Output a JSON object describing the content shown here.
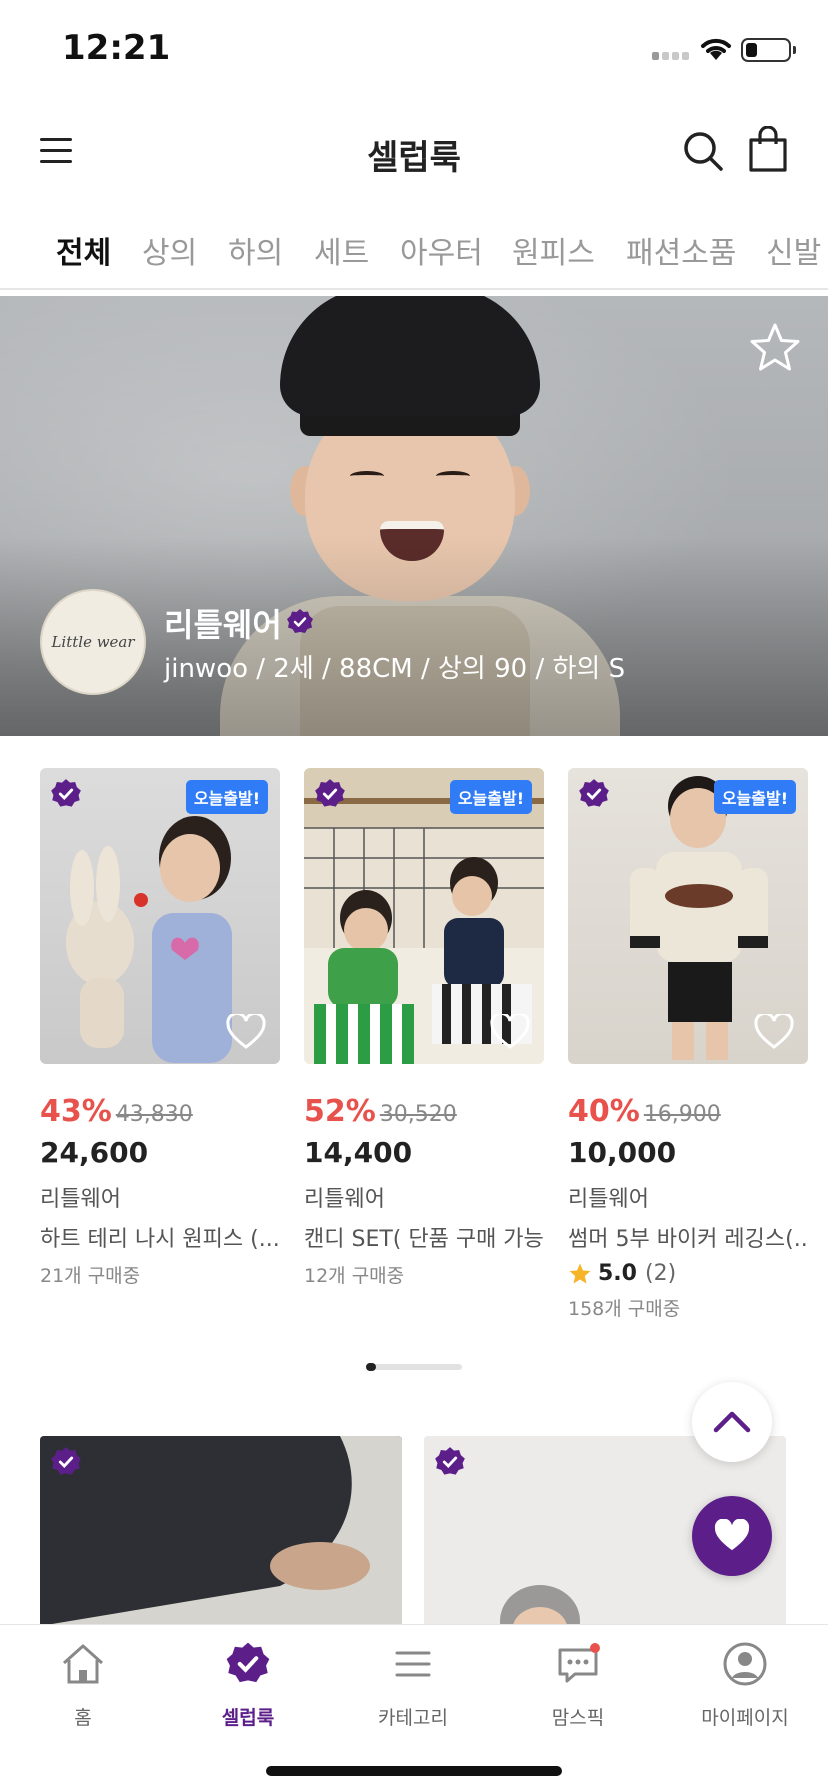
{
  "status_bar": {
    "time": "12:21"
  },
  "header": {
    "title": "셀럽룩"
  },
  "tabs": [
    {
      "label": "전체",
      "active": true
    },
    {
      "label": "상의"
    },
    {
      "label": "하의"
    },
    {
      "label": "세트"
    },
    {
      "label": "아우터"
    },
    {
      "label": "원피스"
    },
    {
      "label": "패션소품"
    },
    {
      "label": "신발"
    }
  ],
  "hero": {
    "brand_name": "리틀웨어",
    "brand_info": "jinwoo / 2세 / 88CM / 상의 90 / 하의 S",
    "logo_text": "Little wear"
  },
  "products": [
    {
      "badge": "오늘출발!",
      "discount": "43%",
      "original_price": "43,830",
      "price": "24,600",
      "brand": "리틀웨어",
      "name": "하트 테리 나시 원피스 (...",
      "sold": "21개 구매중"
    },
    {
      "badge": "오늘출발!",
      "discount": "52%",
      "original_price": "30,520",
      "price": "14,400",
      "brand": "리틀웨어",
      "name": "캔디 SET( 단품 구매 가능)",
      "sold": "12개 구매중"
    },
    {
      "badge": "오늘출발!",
      "discount": "40%",
      "original_price": "16,900",
      "price": "10,000",
      "brand": "리틀웨어",
      "name": "썸머 5부 바이커 레깅스(...",
      "rating": "5.0",
      "rating_count": "(2)",
      "sold": "158개 구매중"
    }
  ],
  "nav": [
    {
      "label": "홈",
      "icon": "home-icon"
    },
    {
      "label": "셀럽룩",
      "icon": "verified-badge-icon",
      "active": true
    },
    {
      "label": "카테고리",
      "icon": "list-icon"
    },
    {
      "label": "맘스픽",
      "icon": "chat-icon"
    },
    {
      "label": "마이페이지",
      "icon": "user-icon"
    }
  ],
  "colors": {
    "brand_purple": "#5c1f8a",
    "discount_red": "#e8524c",
    "badge_blue": "#2f7cf6"
  }
}
